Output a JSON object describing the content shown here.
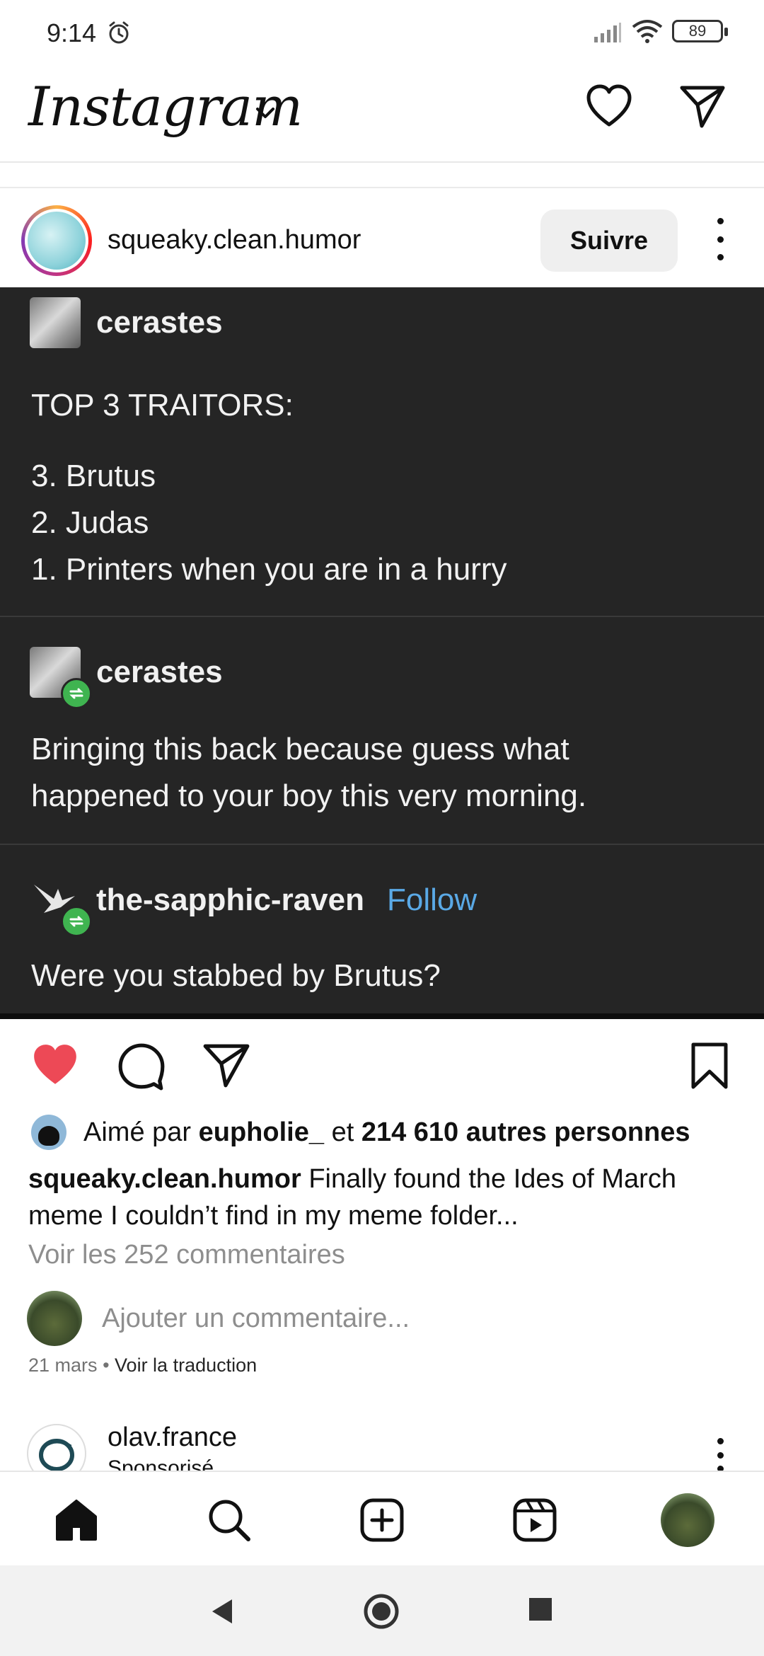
{
  "status_bar": {
    "time": "9:14",
    "battery": "89",
    "icons": [
      "alarm-icon",
      "signal-icon",
      "wifi-icon",
      "battery-icon"
    ]
  },
  "app_header": {
    "logo": "Instagram",
    "icons": [
      "chevron-down-icon",
      "heart-icon",
      "send-icon"
    ]
  },
  "post": {
    "username": "squeaky.clean.humor",
    "follow_label": "Suivre",
    "image": {
      "blocks": [
        {
          "user": "cerastes",
          "lines": [
            "TOP 3 TRAITORS:",
            "3. Brutus",
            "2. Judas",
            "1. Printers when you are in a hurry"
          ]
        },
        {
          "user": "cerastes",
          "lines": [
            "Bringing this back because guess what",
            "happened to your boy this very morning."
          ]
        },
        {
          "user": "the-sapphic-raven",
          "follow": "Follow",
          "lines": [
            "Were you stabbed by Brutus?"
          ]
        }
      ]
    },
    "liked_by": {
      "prefix": "Aimé par",
      "user": "eupholie_",
      "connector": "et",
      "others": "214 610 autres personnes"
    },
    "caption": {
      "user": "squeaky.clean.humor",
      "text": "Finally found the Ides of March meme I couldn’t find in my meme folder..."
    },
    "view_comments": "Voir les 252 commentaires",
    "add_comment_placeholder": "Ajouter un commentaire...",
    "date": "21 mars",
    "separator": "•",
    "translate": "Voir la traduction",
    "accent_like_color": "#ed4956"
  },
  "next_post": {
    "username": "olav.france",
    "subtitle": "Sponsorisé"
  },
  "tab_bar": {
    "tabs": [
      "home-icon",
      "search-icon",
      "create-icon",
      "reels-icon",
      "profile-avatar"
    ]
  },
  "system_nav": {
    "buttons": [
      "back-icon",
      "home-circle-icon",
      "recents-icon"
    ]
  }
}
